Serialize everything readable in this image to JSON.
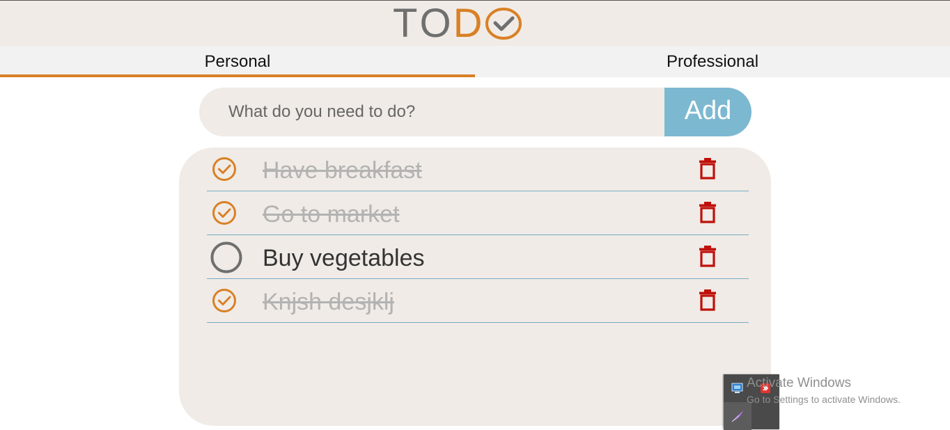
{
  "logo": {
    "letters": [
      "T",
      "O",
      "D"
    ],
    "accent_color": "#d98025",
    "icon": "check-circle-icon"
  },
  "tabs": [
    {
      "label": "Personal",
      "active": true
    },
    {
      "label": "Professional",
      "active": false
    }
  ],
  "add_form": {
    "placeholder": "What do you need to do?",
    "value": "",
    "button_label": "Add",
    "button_color": "#7db8d1"
  },
  "todos": [
    {
      "text": "Have breakfast",
      "done": true
    },
    {
      "text": "Go to market",
      "done": true
    },
    {
      "text": "Buy vegetables",
      "done": false
    },
    {
      "text": "Knjsh desjklj",
      "done": true
    }
  ],
  "colors": {
    "done_check": "#d98025",
    "open_check": "#6f6f6f",
    "trash": "#c0100b",
    "panel_bg": "#f0ebe6"
  },
  "watermark": {
    "title": "Activate Windows",
    "subtitle": "Go to Settings to activate Windows."
  },
  "tray": {
    "icons": [
      "network-monitor-icon",
      "red-arrow-app-icon",
      "feather-pen-icon"
    ]
  }
}
